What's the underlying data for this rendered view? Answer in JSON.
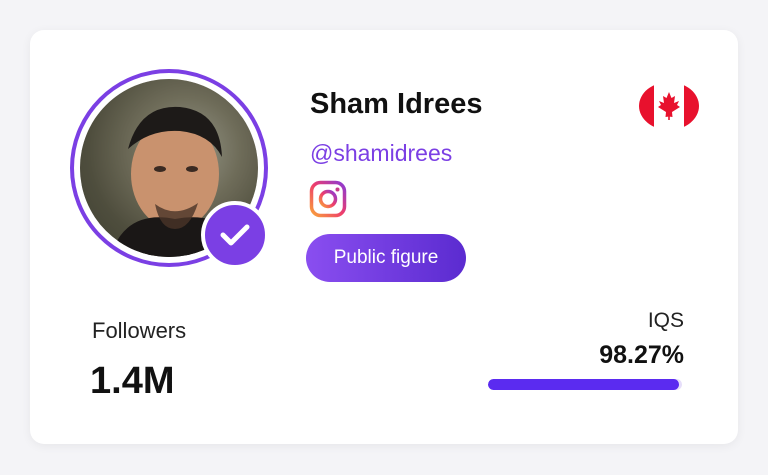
{
  "profile": {
    "name": "Sham Idrees",
    "handle": "@shamidrees",
    "category": "Public figure",
    "platform_icon": "instagram-icon",
    "country_flag": "canada-flag-icon",
    "verified_icon": "check-icon"
  },
  "stats": {
    "followers_label": "Followers",
    "followers_value": "1.4M",
    "iqs_label": "IQS",
    "iqs_value": "98.27%",
    "iqs_fraction": 0.9827
  },
  "colors": {
    "accent": "#7b3fe4",
    "bar": "#5b2bf0",
    "flag_red": "#e8112d"
  }
}
